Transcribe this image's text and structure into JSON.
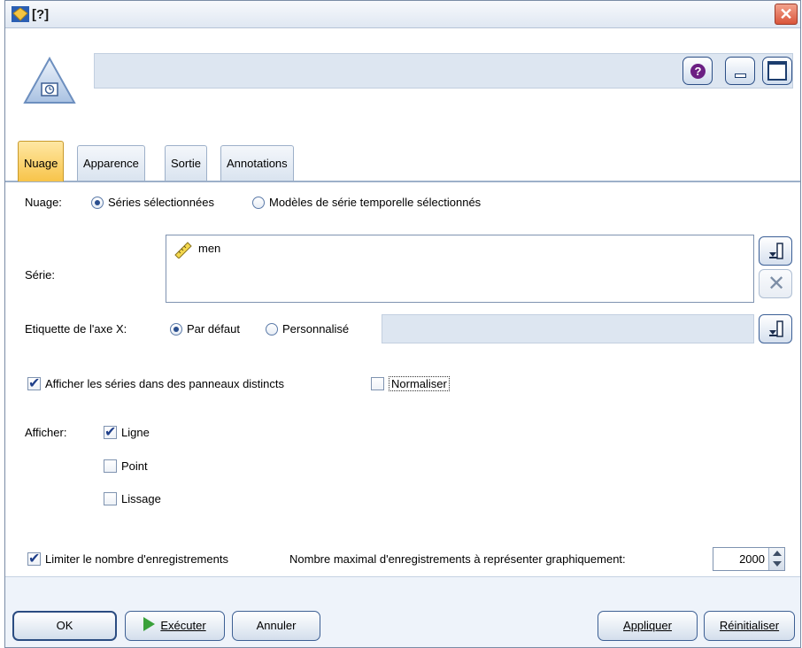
{
  "window": {
    "title": "[?]",
    "close_glyph": "✕"
  },
  "header": {
    "help_glyph": "?",
    "node_name_value": ""
  },
  "tabs": [
    {
      "label": "Nuage",
      "active": true
    },
    {
      "label": "Apparence",
      "active": false
    },
    {
      "label": "Sortie",
      "active": false
    },
    {
      "label": "Annotations",
      "active": false
    }
  ],
  "plot": {
    "label": "Nuage:",
    "options": [
      {
        "label": "Séries sélectionnées",
        "checked": true
      },
      {
        "label": "Modèles de série temporelle sélectionnés",
        "checked": false
      }
    ]
  },
  "series": {
    "label": "Série:",
    "items": [
      "men"
    ]
  },
  "xaxis": {
    "label": "Etiquette de l'axe X:",
    "options": [
      {
        "label": "Par défaut",
        "checked": true
      },
      {
        "label": "Personnalisé",
        "checked": false
      }
    ],
    "custom_value": ""
  },
  "panels": {
    "separate_label": "Afficher les séries dans des panneaux distincts",
    "separate_checked": true,
    "normalize_label": "Normaliser",
    "normalize_checked": false
  },
  "display": {
    "label": "Afficher:",
    "options": [
      {
        "label": "Ligne",
        "checked": true
      },
      {
        "label": "Point",
        "checked": false
      },
      {
        "label": "Lissage",
        "checked": false
      }
    ]
  },
  "limit": {
    "label": "Limiter le nombre d'enregistrements",
    "checked": true,
    "max_label": "Nombre maximal d'enregistrements à représenter graphiquement:",
    "max_value": "2000"
  },
  "footer": {
    "ok": "OK",
    "run": "Exécuter",
    "cancel": "Annuler",
    "apply": "Appliquer",
    "reset": "Réinitialiser"
  },
  "colors": {
    "active_tab": "#f7c44a",
    "run_icon": "#3aa13a",
    "help_icon": "#6b1f83",
    "close_button": "#d9553b"
  },
  "icons": {
    "title": "diamond-node-icon",
    "node": "timeplot-node-icon",
    "series_field": "ruler-icon",
    "field_picker": "field-picker-icon",
    "remove": "delete-x-icon"
  }
}
